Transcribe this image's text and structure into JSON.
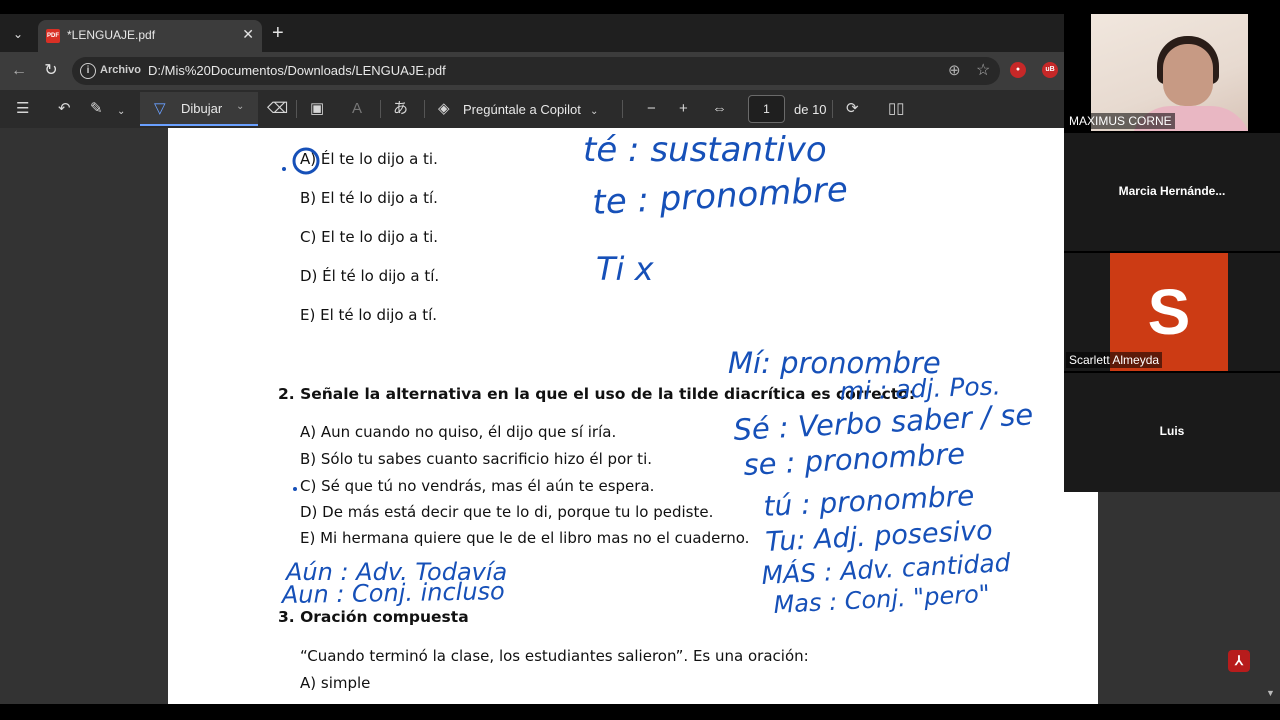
{
  "browser": {
    "tab_title": "*LENGUAJE.pdf",
    "address_chip": "Archivo",
    "url": "D:/Mis%20Documentos/Downloads/LENGUAJE.pdf"
  },
  "pdf_toolbar": {
    "draw_label": "Dibujar",
    "copilot_label": "Pregúntale a Copilot",
    "page_current": "1",
    "page_total_label": "de 10"
  },
  "document": {
    "q1_options": [
      "A) Él te lo dijo a ti.",
      "B) El té lo dijo a tí.",
      "C) El te lo dijo a ti.",
      "D) Él té lo dijo a tí.",
      "E) El té lo dijo a tí."
    ],
    "q2_title": "2. Señale la alternativa en la que el uso de la tilde diacrítica es correcto:",
    "q2_options": [
      "A) Aun cuando no quiso, él dijo que sí iría.",
      "B) Sólo tu sabes cuanto sacrificio hizo él por ti.",
      "C) Sé que tú no vendrás, mas él aún te espera.",
      "D) De más está decir que te lo di, porque tu lo pediste.",
      "E) Mi hermana quiere que le de el libro mas no el cuaderno."
    ],
    "q3_title": "3. Oración compuesta",
    "q3_prompt": "“Cuando terminó la clase, los estudiantes salieron”. Es una oración:",
    "q3_options": [
      "A) simple"
    ]
  },
  "annotations": {
    "top": [
      "té : sustantivo",
      "te : pronombre",
      "Ti x"
    ],
    "right": [
      "Mí: pronombre",
      "mi : adj. Pos.",
      "Sé : Verbo saber / se",
      "se : pronombre",
      "tú : pronombre",
      "Tu: Adj. posesivo",
      "MÁS : Adv. cantidad",
      "Mas : Conj. \"pero\""
    ],
    "left": [
      "Aún : Adv. Todavía",
      "Aun : Conj. incluso"
    ]
  },
  "participants": [
    {
      "name": "MAXIMUS CORNE"
    },
    {
      "name": "Marcia  Hernánde..."
    },
    {
      "name": "Scarlett Almeyda",
      "initial": "S"
    },
    {
      "name": "Luis"
    }
  ],
  "colors": {
    "ink": "#1650b8",
    "accent": "#6aa0ff",
    "avatar": "#cc3b14"
  }
}
